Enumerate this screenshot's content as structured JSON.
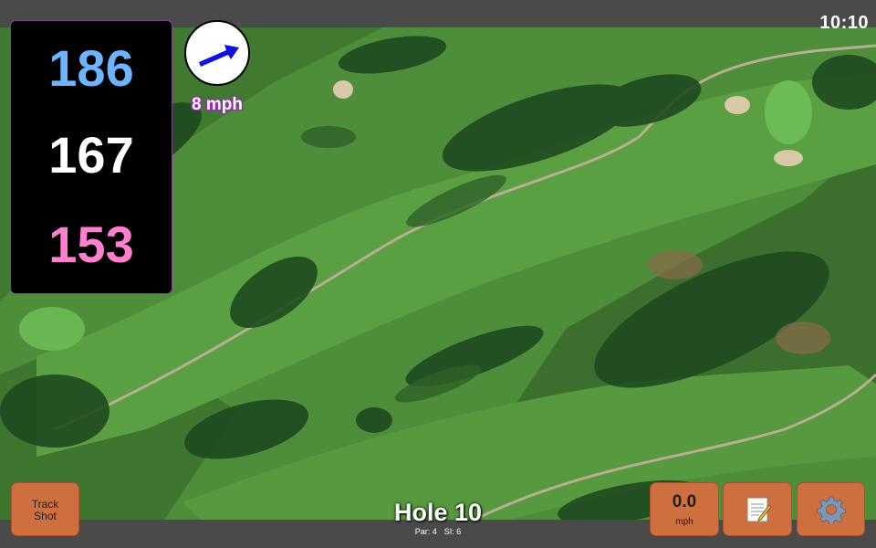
{
  "status": {
    "time": "10:10"
  },
  "distances": {
    "back": "186",
    "center": "167",
    "front": "153"
  },
  "wind": {
    "speed": "8 mph",
    "icon": "wind-arrow-icon"
  },
  "hole": {
    "title": "Hole 10",
    "par": "Par: 4",
    "si": "SI: 6"
  },
  "buttons": {
    "track_shot": "Track\nShot",
    "speed_value": "0.0",
    "speed_unit": "mph",
    "notes_icon": "notepad-icon",
    "settings_icon": "gear-icon"
  },
  "colors": {
    "back": "#6cb4ff",
    "center": "#ffffff",
    "front": "#ff7fcf",
    "button": "#cf6e3f",
    "panel_border": "#8b3f8f"
  }
}
